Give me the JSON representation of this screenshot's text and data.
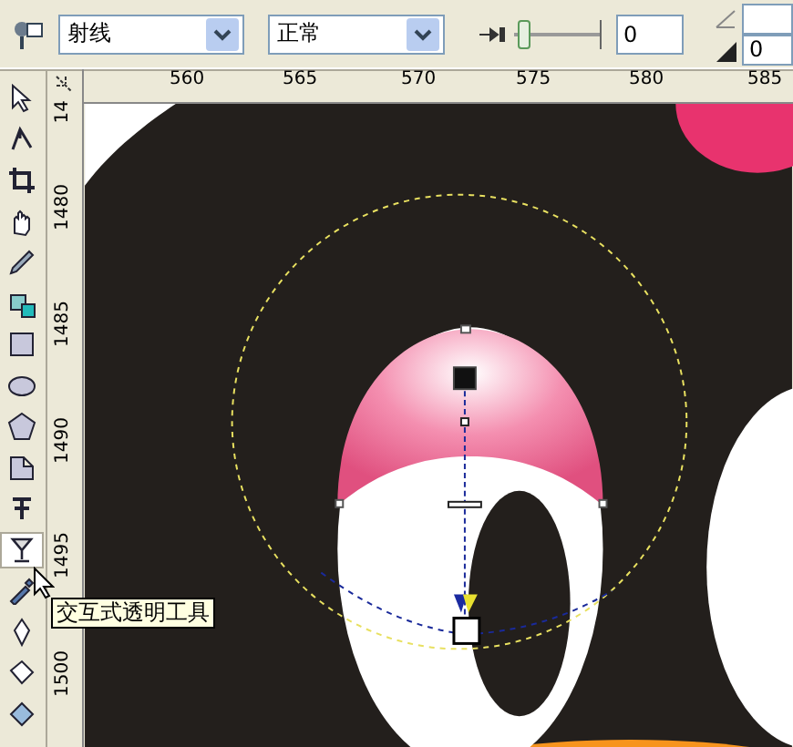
{
  "property_bar": {
    "dropdowns": [
      {
        "value": "射线"
      },
      {
        "value": "正常"
      }
    ],
    "slider": {
      "level": 0.04
    },
    "opacity_field": {
      "value": "0"
    },
    "angle_field": {
      "value": "0"
    }
  },
  "horizontal_ruler": {
    "labels": [
      "560",
      "565",
      "570",
      "575",
      "580",
      "585"
    ]
  },
  "vertical_ruler": {
    "labels": [
      "14",
      "1480",
      "1485",
      "1490",
      "1495",
      "1500"
    ]
  },
  "toolbox": [
    {
      "kind": "pointer",
      "selected": false
    },
    {
      "kind": "shape",
      "selected": false
    },
    {
      "kind": "crop",
      "selected": false
    },
    {
      "kind": "hand",
      "selected": false
    },
    {
      "kind": "pen",
      "selected": false
    },
    {
      "kind": "smartfill",
      "selected": false
    },
    {
      "kind": "rectangle",
      "selected": false
    },
    {
      "kind": "ellipse",
      "selected": false
    },
    {
      "kind": "polygon",
      "selected": false
    },
    {
      "kind": "shapes",
      "selected": false
    },
    {
      "kind": "text",
      "selected": false
    },
    {
      "kind": "transparency",
      "selected": true
    },
    {
      "kind": "eyedropper",
      "selected": false
    },
    {
      "kind": "outline",
      "selected": false
    },
    {
      "kind": "fill",
      "selected": false
    },
    {
      "kind": "interactive-fill",
      "selected": false
    }
  ],
  "tooltip": {
    "text": "交互式透明工具"
  }
}
